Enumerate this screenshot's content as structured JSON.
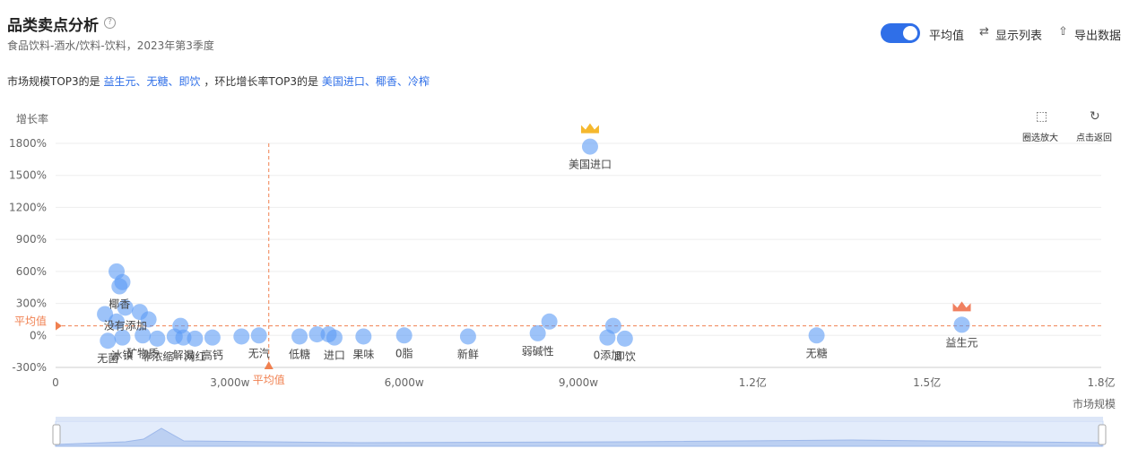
{
  "header": {
    "title": "品类卖点分析",
    "help_icon": "question-circle-icon",
    "subtitle": "食品饮料-酒水/饮料-饮料，2023年第3季度"
  },
  "summary": {
    "prefix": "市场规模TOP3的是",
    "market_top3": [
      "益生元",
      "无糖",
      "即饮"
    ],
    "separator": "、",
    "middle": "，环比增长率TOP3的是",
    "growth_top3": [
      "美国进口",
      "椰香",
      "冷榨"
    ]
  },
  "toolbar": {
    "average_toggle_on": true,
    "average_label": "平均值",
    "show_list_label": "显示列表",
    "export_label": "导出数据"
  },
  "chart_tools": {
    "zoom_label": "圈选放大",
    "reset_label": "点击返回"
  },
  "colors": {
    "accent": "#2f6fe8",
    "bubble": "#5b9bf5",
    "average": "#f08050",
    "crown_gold": "#f5b82e",
    "crown_orange": "#f08060"
  },
  "chart_data": {
    "type": "scatter",
    "ylabel": "增长率",
    "xlabel": "市场规模",
    "x_unit": "万",
    "xlim": [
      0,
      18000
    ],
    "ylim": [
      -300,
      1800
    ],
    "x_ticks": [
      {
        "value": 0,
        "label": "0"
      },
      {
        "value": 3000,
        "label": "3,000w"
      },
      {
        "value": 6000,
        "label": "6,000w"
      },
      {
        "value": 9000,
        "label": "9,000w"
      },
      {
        "value": 12000,
        "label": "1.2亿"
      },
      {
        "value": 15000,
        "label": "1.5亿"
      },
      {
        "value": 18000,
        "label": "1.8亿"
      }
    ],
    "y_ticks": [
      {
        "value": 1800,
        "label": "1800%"
      },
      {
        "value": 1500,
        "label": "1500%"
      },
      {
        "value": 1200,
        "label": "1200%"
      },
      {
        "value": 900,
        "label": "900%"
      },
      {
        "value": 600,
        "label": "600%"
      },
      {
        "value": 300,
        "label": "300%"
      },
      {
        "value": 0,
        "label": "0%"
      },
      {
        "value": -300,
        "label": "-300%"
      }
    ],
    "average": {
      "x": 3670,
      "y": 90,
      "x_label": "平均值",
      "y_label": "平均值"
    },
    "points": [
      {
        "name": "美国进口",
        "x": 9200,
        "y": 1770,
        "crown": "gold"
      },
      {
        "name": "益生元",
        "x": 15600,
        "y": 100,
        "crown": "orange"
      },
      {
        "name": "无糖",
        "x": 13100,
        "y": 0
      },
      {
        "name": "即饮",
        "x": 9800,
        "y": -30
      },
      {
        "name": "0添加",
        "x": 9500,
        "y": -20
      },
      {
        "name": "",
        "x": 9600,
        "y": 90
      },
      {
        "name": "弱碱性",
        "x": 8300,
        "y": 20
      },
      {
        "name": "",
        "x": 8500,
        "y": 130
      },
      {
        "name": "新鲜",
        "x": 7100,
        "y": -10
      },
      {
        "name": "0脂",
        "x": 6000,
        "y": 0
      },
      {
        "name": "果味",
        "x": 5300,
        "y": -10
      },
      {
        "name": "进口",
        "x": 4800,
        "y": -20
      },
      {
        "name": "",
        "x": 4700,
        "y": 10
      },
      {
        "name": "",
        "x": 4500,
        "y": 10
      },
      {
        "name": "低糖",
        "x": 4200,
        "y": -10
      },
      {
        "name": "无汽",
        "x": 3500,
        "y": 0
      },
      {
        "name": "",
        "x": 3200,
        "y": -10
      },
      {
        "name": "高钙",
        "x": 2700,
        "y": -20
      },
      {
        "name": "网红",
        "x": 2400,
        "y": -30
      },
      {
        "name": "解渴",
        "x": 2200,
        "y": -20
      },
      {
        "name": "",
        "x": 2150,
        "y": 90
      },
      {
        "name": "",
        "x": 2050,
        "y": -10
      },
      {
        "name": "非浓缩",
        "x": 1750,
        "y": -30
      },
      {
        "name": "矿物质",
        "x": 1500,
        "y": 0
      },
      {
        "name": "",
        "x": 1600,
        "y": 150
      },
      {
        "name": "",
        "x": 1450,
        "y": 220
      },
      {
        "name": "冰镇",
        "x": 1150,
        "y": -20
      },
      {
        "name": "无菌",
        "x": 900,
        "y": -50
      },
      {
        "name": "",
        "x": 850,
        "y": 200
      },
      {
        "name": "",
        "x": 1050,
        "y": 130
      },
      {
        "name": "没有添加",
        "x": 1200,
        "y": 260
      },
      {
        "name": "椰香",
        "x": 1100,
        "y": 460
      },
      {
        "name": "",
        "x": 1050,
        "y": 600
      },
      {
        "name": "",
        "x": 1150,
        "y": 500
      }
    ]
  }
}
